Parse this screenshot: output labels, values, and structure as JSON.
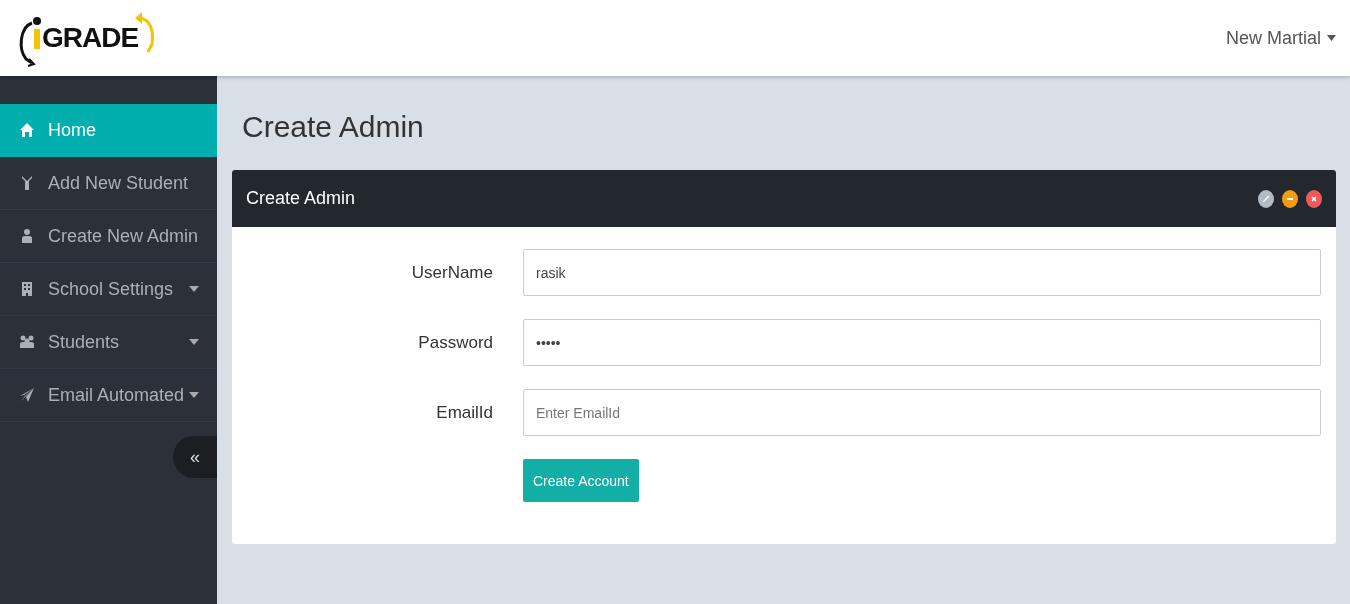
{
  "header": {
    "logo": "GRADE",
    "user_menu": "New Martial"
  },
  "sidebar": {
    "items": [
      {
        "label": "Home",
        "selected": true,
        "expandable": false
      },
      {
        "label": "Add New Student",
        "selected": false,
        "expandable": false
      },
      {
        "label": "Create New Admin",
        "selected": false,
        "expandable": false
      },
      {
        "label": "School Settings",
        "selected": false,
        "expandable": true
      },
      {
        "label": "Students",
        "selected": false,
        "expandable": true
      },
      {
        "label": "Email Automated",
        "selected": false,
        "expandable": true
      }
    ],
    "collapse_button": "«"
  },
  "page_title": "Create Admin",
  "panel": {
    "title": "Create Admin",
    "fields": [
      {
        "label": "UserName",
        "value": "rasik"
      },
      {
        "label": "Password",
        "value": "•••••"
      },
      {
        "label": "EmailId",
        "placeholder": "Enter EmailId"
      }
    ],
    "submit_button": "Create Account"
  }
}
